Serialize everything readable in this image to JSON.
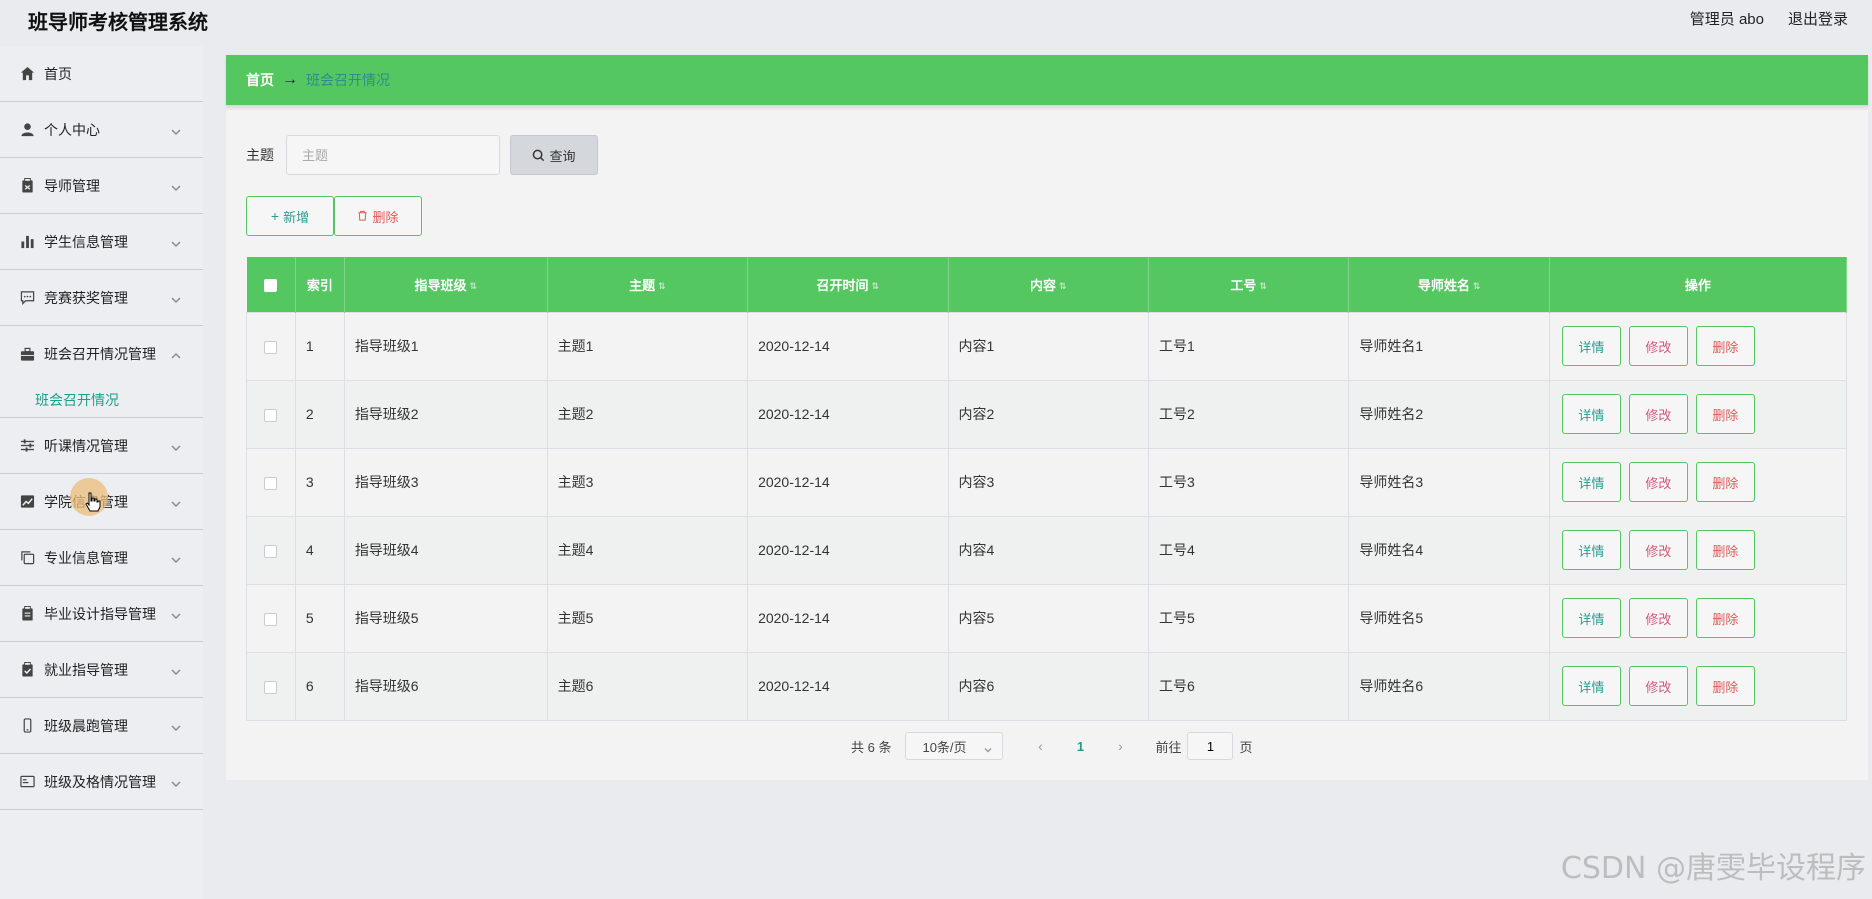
{
  "header": {
    "app_title": "班导师考核管理系统",
    "user_label": "管理员 abo",
    "logout_label": "退出登录"
  },
  "sidebar": {
    "items": [
      {
        "label": "首页",
        "icon": "home-icon"
      },
      {
        "label": "个人中心",
        "icon": "user-icon"
      },
      {
        "label": "导师管理",
        "icon": "clipboard-icon"
      },
      {
        "label": "学生信息管理",
        "icon": "bar-chart-icon"
      },
      {
        "label": "竞赛获奖管理",
        "icon": "chat-icon"
      },
      {
        "label": "班会召开情况管理",
        "icon": "briefcase-icon"
      },
      {
        "label": "听课情况管理",
        "icon": "sliders-icon"
      },
      {
        "label": "学院信息管理",
        "icon": "trend-icon"
      },
      {
        "label": "专业信息管理",
        "icon": "copy-icon"
      },
      {
        "label": "毕业设计指导管理",
        "icon": "clipboard-icon"
      },
      {
        "label": "就业指导管理",
        "icon": "clipboard-check-icon"
      },
      {
        "label": "班级晨跑管理",
        "icon": "phone-icon"
      },
      {
        "label": "班级及格情况管理",
        "icon": "id-card-icon"
      }
    ],
    "active_sub": "班会召开情况"
  },
  "breadcrumb": {
    "home": "首页",
    "arrow": "→",
    "current": "班会召开情况"
  },
  "search": {
    "label": "主题",
    "placeholder": "主题",
    "button": "查询"
  },
  "actions": {
    "add": "新增",
    "delete": "删除"
  },
  "table": {
    "headers": [
      "索引",
      "指导班级",
      "主题",
      "召开时间",
      "内容",
      "工号",
      "导师姓名",
      "操作"
    ],
    "rows": [
      [
        "1",
        "指导班级1",
        "主题1",
        "2020-12-14",
        "内容1",
        "工号1",
        "导师姓名1"
      ],
      [
        "2",
        "指导班级2",
        "主题2",
        "2020-12-14",
        "内容2",
        "工号2",
        "导师姓名2"
      ],
      [
        "3",
        "指导班级3",
        "主题3",
        "2020-12-14",
        "内容3",
        "工号3",
        "导师姓名3"
      ],
      [
        "4",
        "指导班级4",
        "主题4",
        "2020-12-14",
        "内容4",
        "工号4",
        "导师姓名4"
      ],
      [
        "5",
        "指导班级5",
        "主题5",
        "2020-12-14",
        "内容5",
        "工号5",
        "导师姓名5"
      ],
      [
        "6",
        "指导班级6",
        "主题6",
        "2020-12-14",
        "内容6",
        "工号6",
        "导师姓名6"
      ]
    ],
    "row_actions": {
      "detail": "详情",
      "edit": "修改",
      "delete": "删除"
    }
  },
  "pagination": {
    "total": "共 6 条",
    "page_size": "10条/页",
    "current_page": "1",
    "goto_label": "前往",
    "goto_value": "1",
    "goto_suffix": "页"
  },
  "watermark": "CSDN @唐雯毕设程序",
  "colors": {
    "accent": "#55c760",
    "teal": "#1aa08a",
    "danger": "#e05a5a"
  }
}
